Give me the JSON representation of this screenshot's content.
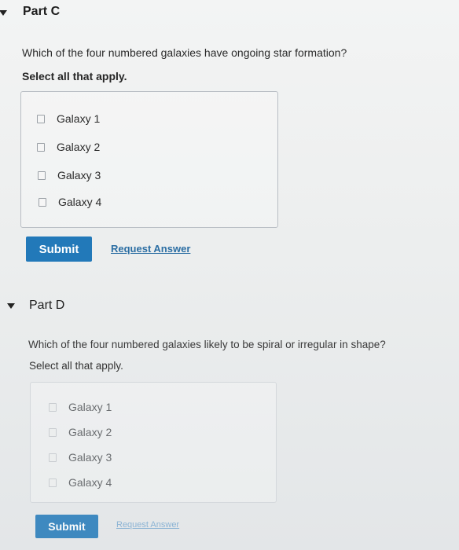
{
  "partC": {
    "title": "Part C",
    "question": "Which of the four numbered galaxies have ongoing star formation?",
    "instruction": "Select all that apply.",
    "options": [
      "Galaxy 1",
      "Galaxy 2",
      "Galaxy 3",
      "Galaxy 4"
    ],
    "submit_label": "Submit",
    "request_label": "Request Answer"
  },
  "partD": {
    "title": "Part D",
    "question": "Which of the four numbered galaxies likely to be spiral or irregular in shape?",
    "instruction": "Select all that apply.",
    "options": [
      "Galaxy 1",
      "Galaxy 2",
      "Galaxy 3",
      "Galaxy 4"
    ],
    "submit_label": "Submit",
    "request_label": "Request Answer"
  },
  "colors": {
    "button": "#2279b9",
    "link": "#2b6ea3",
    "border": "#b9bec4"
  },
  "icons": [
    "collapse-arrow-icon",
    "checkbox-icon"
  ]
}
